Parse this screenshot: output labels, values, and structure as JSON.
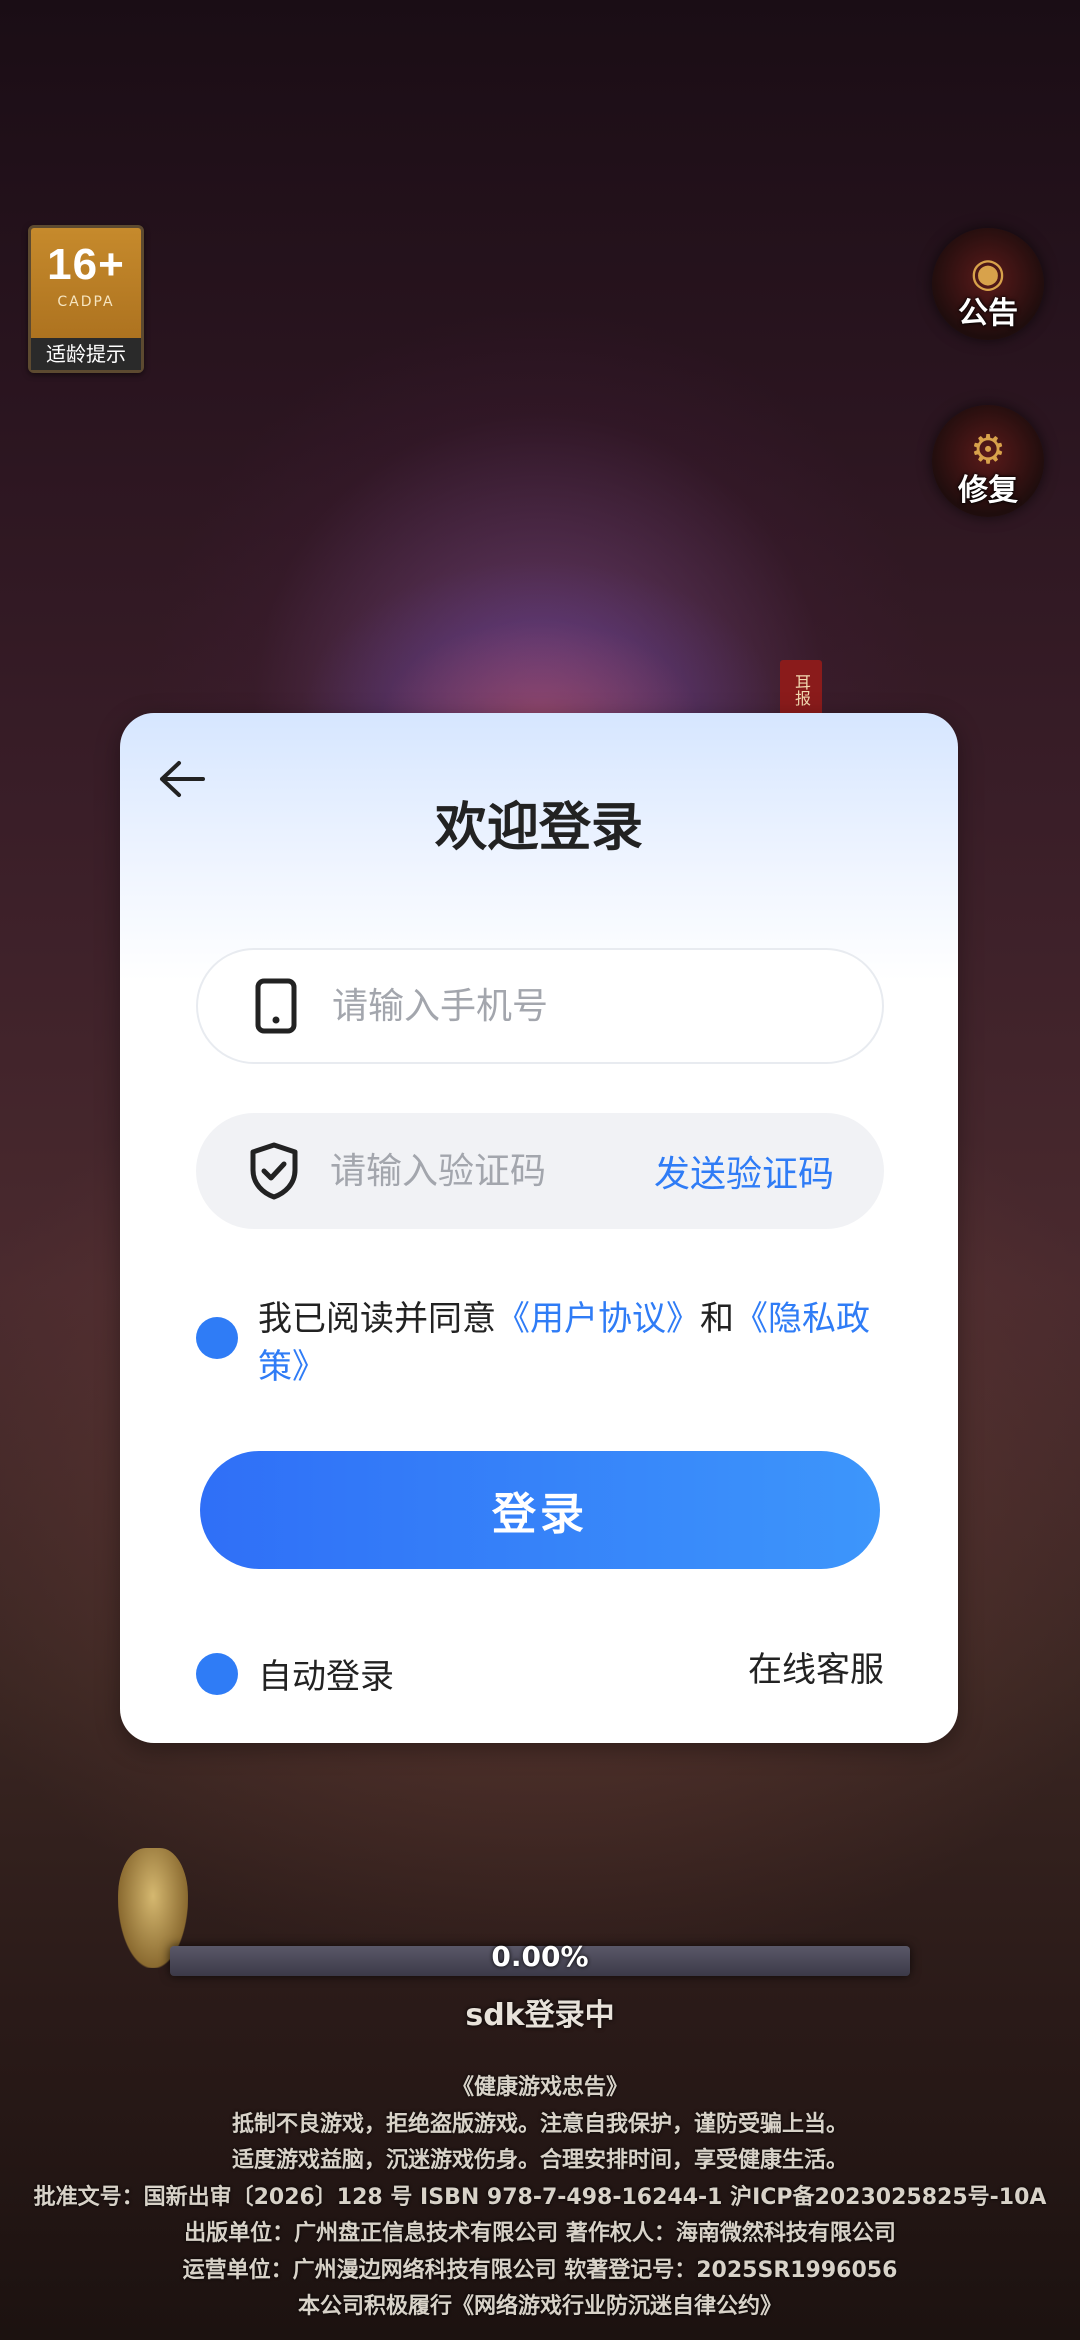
{
  "age_rating": {
    "age": "16+",
    "org": "CADPA",
    "tip": "适龄提示"
  },
  "side_buttons": {
    "notice": "公告",
    "repair": "修复"
  },
  "seal_tag": "耳报",
  "dialog": {
    "title": "欢迎登录",
    "phone_placeholder": "请输入手机号",
    "code_placeholder": "请输入验证码",
    "send_code": "发送验证码",
    "agree_prefix": "我已阅读并同意",
    "user_agreement": "《用户协议》",
    "agree_and": "和",
    "privacy_policy": "《隐私政策》",
    "login_button": "登录",
    "auto_login": "自动登录",
    "online_service": "在线客服"
  },
  "progress": {
    "percent_text": "0.00%",
    "value": 0,
    "status": "sdk登录中"
  },
  "notice_lines": [
    "《健康游戏忠告》",
    "抵制不良游戏，拒绝盗版游戏。注意自我保护，谨防受骗上当。",
    "适度游戏益脑，沉迷游戏伤身。合理安排时间，享受健康生活。",
    "批准文号：国新出审〔2026〕128 号 ISBN 978-7-498-16244-1 沪ICP备2023025825号-10A",
    "出版单位：广州盘正信息技术有限公司  著作权人：海南微然科技有限公司",
    "运营单位：广州漫边网络科技有限公司  软著登记号：2025SR1996056",
    "本公司积极履行《网络游戏行业防沉迷自律公约》"
  ],
  "colors": {
    "accent": "#2f7cf6",
    "login_gradient_start": "#2f6ff7",
    "login_gradient_end": "#3d96fb"
  }
}
